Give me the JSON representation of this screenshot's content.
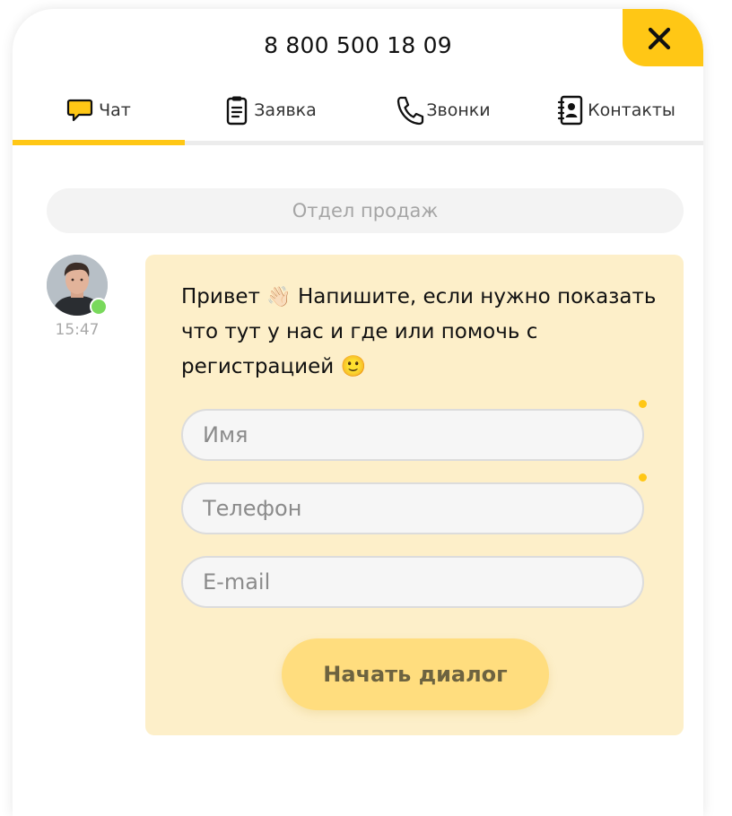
{
  "header": {
    "phone": "8 800 500 18 09",
    "close_icon": "close-icon",
    "accent_color": "#ffc715"
  },
  "tabs": [
    {
      "label": "Чат",
      "icon": "chat-bubble-icon",
      "active": true
    },
    {
      "label": "Заявка",
      "icon": "clipboard-icon",
      "active": false
    },
    {
      "label": "Звонки",
      "icon": "phone-icon",
      "active": false
    },
    {
      "label": "Контакты",
      "icon": "contacts-book-icon",
      "active": false
    }
  ],
  "chat": {
    "department": "Отдел продаж",
    "operator": {
      "time": "15:47",
      "status": "online",
      "avatar_icon": "operator-avatar"
    },
    "message": {
      "part1": "Привет",
      "emoji_wave": "👋🏻",
      "part2": "Напишите, если нужно показать что тут у нас и где или помочь с регистрацией",
      "emoji_smile": "🙂"
    },
    "form": {
      "name_placeholder": "Имя",
      "phone_placeholder": "Телефон",
      "email_placeholder": "E-mail",
      "submit_label": "Начать диалог"
    },
    "bubble_color": "#fdefc9"
  }
}
